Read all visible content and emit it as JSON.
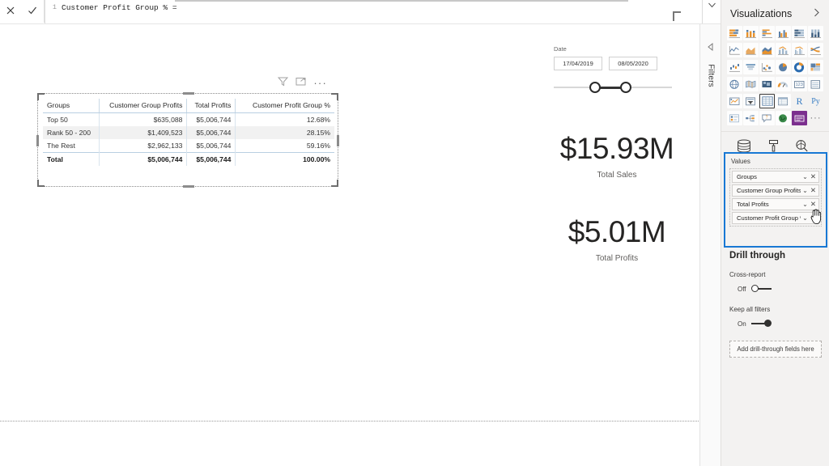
{
  "formula_bar": {
    "cancel_icon": "close-icon",
    "accept_icon": "checkmark-icon",
    "line_number": "1",
    "formula_text": "Customer Profit Group % =",
    "expand_icon": "chevron-down-icon"
  },
  "canvas": {
    "table_visual": {
      "icons": [
        "filter-icon",
        "focus-mode-icon",
        "more-options-icon"
      ],
      "columns": [
        "Groups",
        "Customer Group Profits",
        "Total Profits",
        "Customer Profit Group %"
      ],
      "rows": [
        {
          "group": "Top 50",
          "customer_group_profits": "$635,088",
          "total_profits": "$5,006,744",
          "profit_group_pct": "12.68%"
        },
        {
          "group": "Rank 50 - 200",
          "customer_group_profits": "$1,409,523",
          "total_profits": "$5,006,744",
          "profit_group_pct": "28.15%"
        },
        {
          "group": "The Rest",
          "customer_group_profits": "$2,962,133",
          "total_profits": "$5,006,744",
          "profit_group_pct": "59.16%"
        }
      ],
      "total_row": {
        "group": "Total",
        "customer_group_profits": "$5,006,744",
        "total_profits": "$5,006,744",
        "profit_group_pct": "100.00%"
      }
    },
    "cards": [
      {
        "value": "$15.93M",
        "label": "Total Sales"
      },
      {
        "value": "$5.01M",
        "label": "Total Profits"
      }
    ],
    "slicer": {
      "title": "Date",
      "start_date": "17/04/2019",
      "end_date": "08/05/2020"
    }
  },
  "filters_pane": {
    "label": "Filters",
    "expand_icon": "expand-left-icon"
  },
  "visualizations": {
    "title": "Visualizations",
    "collapse_icon": "chevron-right-icon",
    "icons": [
      "stacked-bar-chart-icon",
      "stacked-column-chart-icon",
      "clustered-bar-chart-icon",
      "clustered-column-chart-icon",
      "100-stacked-bar-chart-icon",
      "100-stacked-column-chart-icon",
      "line-chart-icon",
      "area-chart-icon",
      "stacked-area-chart-icon",
      "line-stacked-column-chart-icon",
      "line-clustered-column-chart-icon",
      "ribbon-chart-icon",
      "waterfall-chart-icon",
      "funnel-icon",
      "scatter-chart-icon",
      "pie-chart-icon",
      "donut-chart-icon",
      "treemap-icon",
      "map-icon",
      "filled-map-icon",
      "shape-map-icon",
      "gauge-icon",
      "card-icon",
      "multi-row-card-icon",
      "kpi-icon",
      "slicer-icon",
      "table-icon",
      "matrix-icon",
      "r-script-visual-icon",
      "python-visual-icon",
      "key-influencers-icon",
      "decomposition-tree-icon",
      "qna-icon",
      "arcgis-map-icon",
      "paginated-report-icon",
      "more-visuals-icon"
    ],
    "selected_icon": "table-icon",
    "highlighted_icon": "paginated-report-icon",
    "pane_tabs": [
      "fields-tab",
      "format-tab",
      "analytics-tab"
    ],
    "active_pane_tab": "fields-tab",
    "values": {
      "section_label": "Values",
      "fields": [
        {
          "name": "Groups",
          "dropdown_icon": "chevron-down-icon",
          "remove_icon": "close-icon"
        },
        {
          "name": "Customer Group Profits",
          "dropdown_icon": "chevron-down-icon",
          "remove_icon": "close-icon"
        },
        {
          "name": "Total Profits",
          "dropdown_icon": "chevron-down-icon",
          "remove_icon": "close-icon"
        },
        {
          "name": "Customer Profit Group %",
          "dropdown_icon": "chevron-down-icon",
          "remove_icon": "close-icon"
        }
      ],
      "highlight_color": "#1878d4"
    },
    "drill_through": {
      "title": "Drill through",
      "cross_report_label": "Cross-report",
      "cross_report_state": "Off",
      "keep_all_filters_label": "Keep all filters",
      "keep_all_filters_state": "On",
      "drop_zone_text": "Add drill-through fields here"
    }
  }
}
